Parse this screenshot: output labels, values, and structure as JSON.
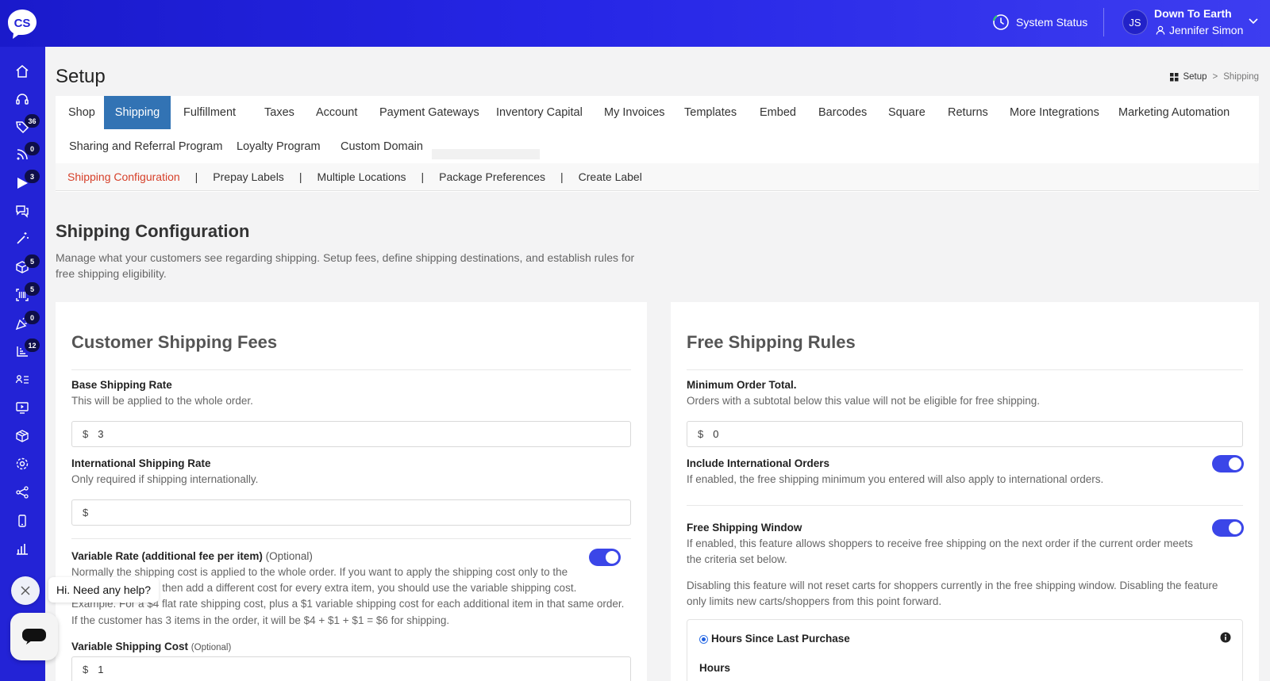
{
  "brand": {
    "logo_text": "CS",
    "primary": "#2323d6",
    "tab_active": "#3273b4",
    "link_active": "#d6402a",
    "toggle_on": "#3b46e8"
  },
  "header": {
    "system_status": "System Status",
    "avatar_initials": "JS",
    "store_name": "Down To Earth",
    "user_name": "Jennifer Simon"
  },
  "sidebar": {
    "items": [
      {
        "icon": "home-icon"
      },
      {
        "icon": "headset-icon"
      },
      {
        "icon": "tag-icon",
        "badge": "36"
      },
      {
        "icon": "rss-icon",
        "badge": "0"
      },
      {
        "icon": "play-icon",
        "badge": "3"
      },
      {
        "icon": "chat-icon"
      },
      {
        "icon": "magic-wand-icon"
      },
      {
        "icon": "box-icon",
        "badge": "5"
      },
      {
        "icon": "barcode-icon",
        "badge": "5"
      },
      {
        "icon": "party-icon",
        "badge": "0"
      },
      {
        "icon": "list-number-icon",
        "badge": "12"
      },
      {
        "icon": "users-list-icon"
      },
      {
        "icon": "video-icon"
      },
      {
        "icon": "package-icon"
      },
      {
        "icon": "settings-icon"
      },
      {
        "icon": "share-icon"
      },
      {
        "icon": "mobile-icon"
      },
      {
        "icon": "bar-chart-icon"
      }
    ]
  },
  "page": {
    "title": "Setup",
    "breadcrumb": {
      "root": "Setup",
      "separator": ">",
      "current": "Shipping"
    }
  },
  "tabs": {
    "row1": [
      "Shop",
      "Shipping",
      "Fulfillment",
      "Taxes",
      "Account",
      "Payment Gateways",
      "Inventory Capital",
      "My Invoices",
      "Templates",
      "Embed",
      "Barcodes",
      "Square",
      "Returns",
      "More Integrations",
      "Marketing Automation"
    ],
    "row2": [
      "Sharing and Referral Program",
      "Loyalty Program",
      "Custom Domain"
    ],
    "active": "Shipping"
  },
  "subnav": {
    "items": [
      "Shipping Configuration",
      "Prepay Labels",
      "Multiple Locations",
      "Package Preferences",
      "Create Label"
    ],
    "separator": "|"
  },
  "section": {
    "title": "Shipping Configuration",
    "description": "Manage what your customers see regarding shipping. Setup fees, define shipping destinations, and establish rules for free shipping eligibility."
  },
  "fees": {
    "title": "Customer Shipping Fees",
    "base": {
      "label": "Base Shipping Rate",
      "help": "This will be applied to the whole order.",
      "currency": "$",
      "value": "3"
    },
    "international": {
      "label": "International Shipping Rate",
      "help": "Only required if shipping internationally.",
      "currency": "$",
      "value": ""
    },
    "variable": {
      "label": "Variable Rate (additional fee per item)",
      "optional": "(Optional)",
      "help_1": "Normally the shipping cost is applied to the whole order. If you want to apply the shipping cost only to the",
      "help_2": "der, then add a different cost for every extra item, you should use the variable shipping cost.",
      "help_3": "Example: For a $4 flat rate shipping cost, plus a $1 variable shipping cost for each additional item in that same order.",
      "help_4": "If the customer has 3 items in the order, it will be $4 + $1 + $1 = $6 for shipping.",
      "enabled": true
    },
    "variable_cost": {
      "label": "Variable Shipping Cost",
      "optional": "(Optional)",
      "currency": "$",
      "value": "1"
    }
  },
  "free": {
    "title": "Free Shipping Rules",
    "min_total": {
      "label": "Minimum Order Total.",
      "help": "Orders with a subtotal below this value will not be eligible for free shipping.",
      "currency": "$",
      "value": "0"
    },
    "international": {
      "label": "Include International Orders",
      "help": "If enabled, the free shipping minimum you entered will also apply to international orders.",
      "enabled": true
    },
    "window": {
      "label": "Free Shipping Window",
      "help_1": "If enabled, this feature allows shoppers to receive free shipping on the next order if the current order meets",
      "help_2": "the criteria set below.",
      "note_1": "Disabling this feature will not reset carts for shoppers currently in the free shipping window. Disabling the feature",
      "note_2": "only limits new carts/shoppers from this point forward.",
      "enabled": true
    },
    "hours_option": {
      "label": "Hours Since Last Purchase",
      "selected": true,
      "hours_label": "Hours"
    }
  },
  "chat": {
    "prompt": "Hi. Need any help?"
  }
}
